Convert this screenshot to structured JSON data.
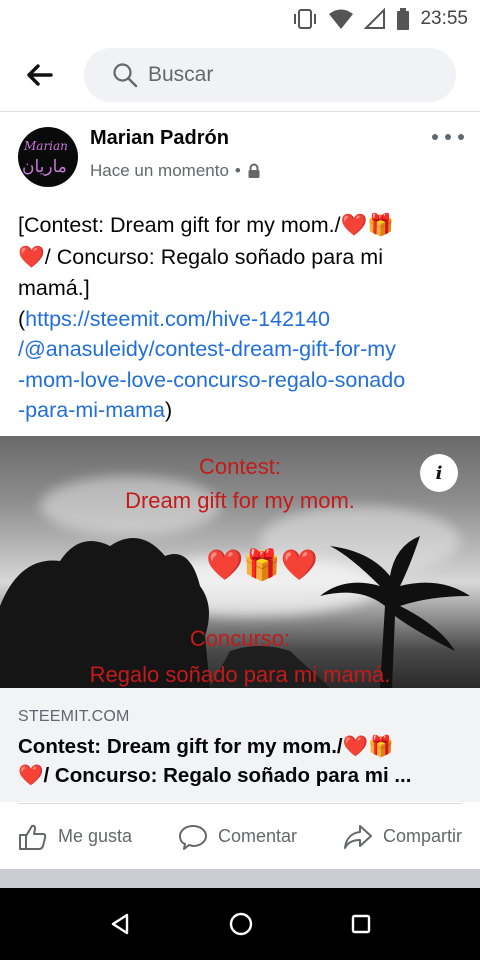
{
  "status_bar": {
    "time": "23:55",
    "icons": [
      "vibrate-icon",
      "wifi-icon",
      "signal-icon",
      "battery-icon"
    ]
  },
  "search": {
    "placeholder": "Buscar",
    "icon": "search-icon"
  },
  "post": {
    "author": "Marian Padrón",
    "timestamp": "Hace un momento",
    "privacy_icon": "lock-icon",
    "avatar_text": {
      "top": "Marian",
      "bottom": "ماريان"
    },
    "text": {
      "line1": "[Contest: Dream gift for my mom./",
      "line2_rest": "/ Concurso: Regalo soñado para mi",
      "line3": "mamá.]",
      "link_open": "(",
      "link_l1": "https://steemit.com/hive-142140",
      "link_l2": "/@anasuleidy/contest-dream-gift-for-my",
      "link_l3": "-mom-love-love-concurso-regalo-sonado",
      "link_l4": "-para-mi-mama",
      "link_close": ")",
      "heart": "❤️",
      "gift": "🎁"
    }
  },
  "preview": {
    "image_text": {
      "line1": "Contest:",
      "line2": "Dream gift for my mom.",
      "line3": "Concurso:",
      "line4": "Regalo soñado para mi mamá."
    },
    "info_label": "i",
    "domain": "STEEMIT.COM",
    "title_line1": "Contest: Dream gift for my mom./",
    "title_line2": "/ Concurso: Regalo soñado para mi ..."
  },
  "actions": {
    "like": "Me gusta",
    "comment": "Comentar",
    "share": "Compartir"
  },
  "colors": {
    "link": "#216fdb",
    "heart": "#e0192c",
    "secondary_text": "#65676b"
  }
}
